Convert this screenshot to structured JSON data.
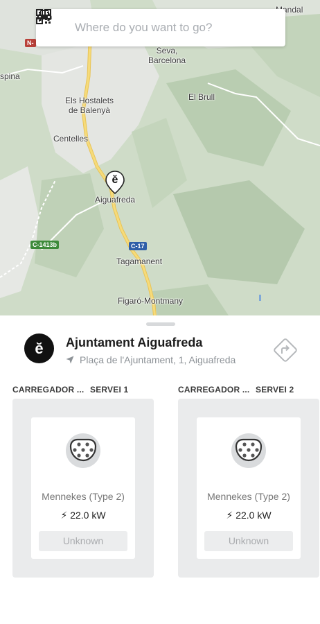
{
  "search": {
    "placeholder": "Where do you want to go?",
    "car_icon": "car-icon",
    "qr_icon": "qr-code-icon"
  },
  "map": {
    "places": [
      {
        "name": "Mandal"
      },
      {
        "name": "Seva,\nBarcelona"
      },
      {
        "name": "El Brull"
      },
      {
        "name": "Els Hostalets\nde Balenyà"
      },
      {
        "name": "Centelles"
      },
      {
        "name": "Aiguafreda"
      },
      {
        "name": "Tagamanent"
      },
      {
        "name": "Figaró-Montmany"
      },
      {
        "name": "spina"
      }
    ],
    "roads": {
      "n_road": "N-",
      "c1413b": "C-1413b",
      "c17": "C-17"
    },
    "pin_glyph": "ĕ"
  },
  "station": {
    "logo_glyph": "ĕ",
    "name": "Ajuntament Aiguafreda",
    "address": "Plaça de l'Ajuntament, 1, Aiguafreda"
  },
  "chargers": [
    {
      "name": "CARREGADOR ...",
      "service": "SERVEI 1",
      "plug_type": "Mennekes (Type 2)",
      "power": "22.0 kW",
      "status": "Unknown"
    },
    {
      "name": "CARREGADOR ...",
      "service": "SERVEI 2",
      "plug_type": "Mennekes (Type 2)",
      "power": "22.0 kW",
      "status": "Unknown"
    }
  ],
  "colors": {
    "map_green": "#c9d8c3",
    "road_yellow": "#f3d36b",
    "card_bg": "#eaebec"
  }
}
